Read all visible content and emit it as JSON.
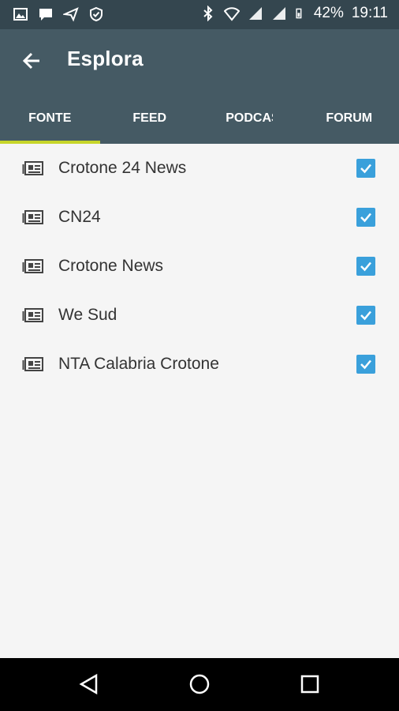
{
  "status_bar": {
    "battery": "42%",
    "time": "19:11",
    "icons": [
      "gallery-icon",
      "message-icon",
      "send-icon",
      "shield-icon",
      "bluetooth-icon",
      "wifi-icon",
      "signal-icon",
      "signal-icon",
      "battery-icon"
    ]
  },
  "app_bar": {
    "title": "Esplora",
    "back_icon": "arrow-back-icon"
  },
  "tabs": [
    {
      "label": "FONTE",
      "active": true
    },
    {
      "label": "FEED",
      "active": false
    },
    {
      "label": "PODCAST",
      "active": false
    },
    {
      "label": "FORUM",
      "active": false
    }
  ],
  "sources": [
    {
      "label": "Crotone 24 News",
      "checked": true,
      "icon": "newspaper-icon"
    },
    {
      "label": "CN24",
      "checked": true,
      "icon": "newspaper-icon"
    },
    {
      "label": "Crotone News",
      "checked": true,
      "icon": "newspaper-icon"
    },
    {
      "label": "We Sud",
      "checked": true,
      "icon": "newspaper-icon"
    },
    {
      "label": "NTA Calabria Crotone",
      "checked": true,
      "icon": "newspaper-icon"
    }
  ],
  "colors": {
    "status_bar": "#34464f",
    "app_bar": "#455a64",
    "tab_indicator": "#c6d52a",
    "checkbox": "#3aa0db",
    "background": "#f5f5f5"
  },
  "nav_bar": {
    "icons": [
      "back-triangle-icon",
      "home-circle-icon",
      "recents-square-icon"
    ]
  }
}
